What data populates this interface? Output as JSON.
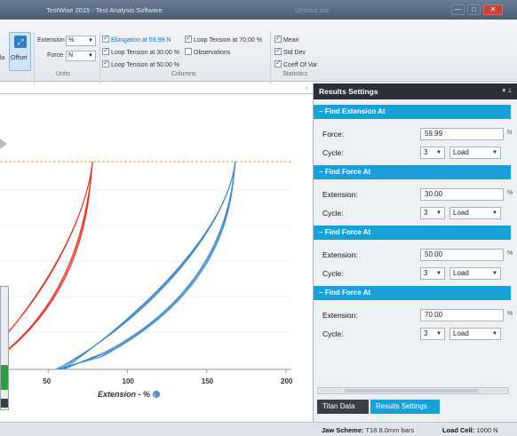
{
  "window": {
    "title": "TestWise 2015 - Test Analysis Software",
    "ghost_title": "Untitled.twx",
    "controls": [
      "—",
      "□",
      "✕"
    ]
  },
  "ribbon": {
    "left_cut_label": "la",
    "offset_label": "Offset",
    "units": {
      "extension_label": "Extension",
      "extension_value": "%",
      "force_label": "Force",
      "force_value": "N",
      "group_label": "Units"
    },
    "columns": {
      "group_label": "Columns",
      "items": [
        {
          "label": "Elongation at 59.99 N",
          "checked": true,
          "highlight": true
        },
        {
          "label": "Loop Tension at 30.00 %",
          "checked": true
        },
        {
          "label": "Loop Tension at 50.00 %",
          "checked": true
        },
        {
          "label": "Loop Tension at 70.00 %",
          "checked": true
        },
        {
          "label": "Observations",
          "checked": false
        }
      ]
    },
    "statistics": {
      "group_label": "Statistics",
      "items": [
        {
          "label": "Mean",
          "checked": true
        },
        {
          "label": "Std Dev",
          "checked": true
        },
        {
          "label": "Coeff Of Var",
          "checked": true
        }
      ]
    }
  },
  "chart_data": {
    "type": "line",
    "xlabel": "Extension - %",
    "xlim": [
      0,
      200
    ],
    "xticks": [
      50,
      100,
      150,
      200
    ],
    "reference_line_force": 59.99,
    "series": [
      {
        "color": "#e03a2f",
        "x": [
          0,
          10,
          20,
          30,
          40,
          50,
          60,
          70,
          75,
          78
        ]
      },
      {
        "color": "#3b86c4",
        "x": [
          55,
          70,
          90,
          110,
          130,
          145,
          155,
          162,
          166,
          168
        ]
      }
    ]
  },
  "panel": {
    "title": "Results Settings",
    "controls": "▾ ⊥",
    "sections": [
      {
        "header": "− Find Extension At",
        "field_label": "Force:",
        "field_value": "59.99",
        "unit_cut": "N",
        "cycle_label": "Cycle:",
        "cycle_value": "3",
        "mode_value": "Load"
      },
      {
        "header": "− Find Force At",
        "field_label": "Extension:",
        "field_value": "30.00",
        "unit_cut": "%",
        "cycle_label": "Cycle:",
        "cycle_value": "3",
        "mode_value": "Load"
      },
      {
        "header": "− Find Force At",
        "field_label": "Extension:",
        "field_value": "50.00",
        "unit_cut": "%",
        "cycle_label": "Cycle:",
        "cycle_value": "3",
        "mode_value": "Load"
      },
      {
        "header": "− Find Force At",
        "field_label": "Extension:",
        "field_value": "70.00",
        "unit_cut": "%",
        "cycle_label": "Cycle:",
        "cycle_value": "3",
        "mode_value": "Load"
      }
    ],
    "tabs": [
      "Titan Data",
      "Results Settings"
    ],
    "active_tab": "Results Settings"
  },
  "status": {
    "jaw_label": "Jaw Scheme:",
    "jaw_value": "T18 8.0mm bars",
    "load_label": "Load Cell:",
    "load_value": "1000 N"
  },
  "icons": [
    "offset-icon",
    "info-icon",
    "collapse-icon",
    "chevron-down-icon"
  ]
}
